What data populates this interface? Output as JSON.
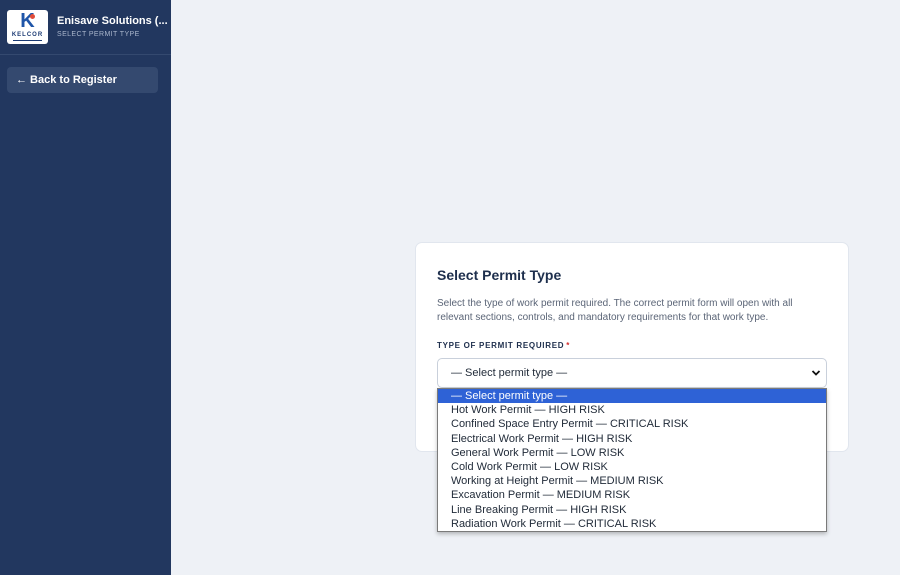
{
  "sidebar": {
    "brand_title": "Enisave Solutions (...",
    "brand_subtitle": "SELECT PERMIT TYPE",
    "logo_text": "KELCOR",
    "logo_letter": "K",
    "back_button": "← Back to Register"
  },
  "card": {
    "title": "Select Permit Type",
    "description": "Select the type of work permit required. The correct permit form will open with all relevant sections, controls, and mandatory requirements for that work type.",
    "field_label": "TYPE OF PERMIT REQUIRED",
    "required_marker": "*",
    "selected_value": "— Select permit type —"
  },
  "dropdown": {
    "options": [
      "— Select permit type —",
      "Hot Work Permit — HIGH RISK",
      "Confined Space Entry Permit — CRITICAL RISK",
      "Electrical Work Permit — HIGH RISK",
      "General Work Permit — LOW RISK",
      "Cold Work Permit — LOW RISK",
      "Working at Height Permit — MEDIUM RISK",
      "Excavation Permit — MEDIUM RISK",
      "Line Breaking Permit — HIGH RISK",
      "Radiation Work Permit — CRITICAL RISK"
    ],
    "highlighted_index": 0
  },
  "colors": {
    "sidebar_bg": "#22375f",
    "page_bg": "#eef1f6",
    "highlight": "#2e62d6",
    "required": "#d32f2f"
  }
}
